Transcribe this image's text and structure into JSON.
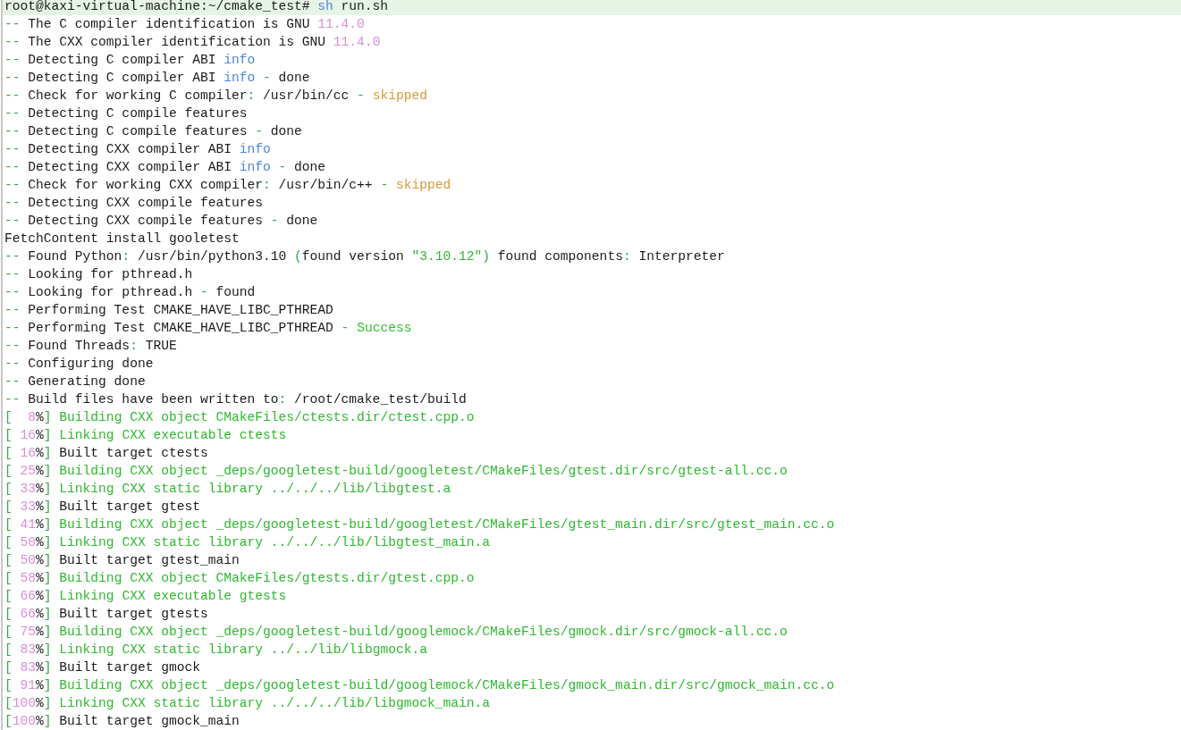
{
  "terminal": {
    "lines": [
      {
        "kind": "prompt",
        "parts": [
          {
            "kind": "text",
            "text": "root@kaxi-virtual-machine:~/cmake_test# "
          },
          {
            "kind": "info",
            "text": "sh"
          },
          {
            "kind": "text",
            "text": " run.sh"
          }
        ]
      },
      {
        "kind": "output",
        "parts": [
          {
            "kind": "dim",
            "text": "-- "
          },
          {
            "kind": "text",
            "text": "The C compiler identification is GNU "
          },
          {
            "kind": "num",
            "text": "11.4.0"
          }
        ]
      },
      {
        "kind": "output",
        "parts": [
          {
            "kind": "dim",
            "text": "-- "
          },
          {
            "kind": "text",
            "text": "The CXX compiler identification is GNU "
          },
          {
            "kind": "num",
            "text": "11.4.0"
          }
        ]
      },
      {
        "kind": "output",
        "parts": [
          {
            "kind": "dim",
            "text": "-- "
          },
          {
            "kind": "text",
            "text": "Detecting C compiler ABI "
          },
          {
            "kind": "info",
            "text": "info"
          }
        ]
      },
      {
        "kind": "output",
        "parts": [
          {
            "kind": "dim",
            "text": "-- "
          },
          {
            "kind": "text",
            "text": "Detecting C compiler ABI "
          },
          {
            "kind": "info",
            "text": "info"
          },
          {
            "kind": "dim",
            "text": " - "
          },
          {
            "kind": "text",
            "text": "done"
          }
        ]
      },
      {
        "kind": "output",
        "parts": [
          {
            "kind": "dim",
            "text": "-- "
          },
          {
            "kind": "text",
            "text": "Check for working C compiler"
          },
          {
            "kind": "dim",
            "text": ": "
          },
          {
            "kind": "text",
            "text": "/usr/bin/cc"
          },
          {
            "kind": "dim",
            "text": " - "
          },
          {
            "kind": "warn",
            "text": "skipped"
          }
        ]
      },
      {
        "kind": "output",
        "parts": [
          {
            "kind": "dim",
            "text": "-- "
          },
          {
            "kind": "text",
            "text": "Detecting C compile features"
          }
        ]
      },
      {
        "kind": "output",
        "parts": [
          {
            "kind": "dim",
            "text": "-- "
          },
          {
            "kind": "text",
            "text": "Detecting C compile features"
          },
          {
            "kind": "dim",
            "text": " - "
          },
          {
            "kind": "text",
            "text": "done"
          }
        ]
      },
      {
        "kind": "output",
        "parts": [
          {
            "kind": "dim",
            "text": "-- "
          },
          {
            "kind": "text",
            "text": "Detecting CXX compiler ABI "
          },
          {
            "kind": "info",
            "text": "info"
          }
        ]
      },
      {
        "kind": "output",
        "parts": [
          {
            "kind": "dim",
            "text": "-- "
          },
          {
            "kind": "text",
            "text": "Detecting CXX compiler ABI "
          },
          {
            "kind": "info",
            "text": "info"
          },
          {
            "kind": "dim",
            "text": " - "
          },
          {
            "kind": "text",
            "text": "done"
          }
        ]
      },
      {
        "kind": "output",
        "parts": [
          {
            "kind": "dim",
            "text": "-- "
          },
          {
            "kind": "text",
            "text": "Check for working CXX compiler"
          },
          {
            "kind": "dim",
            "text": ": "
          },
          {
            "kind": "text",
            "text": "/usr/bin/c++"
          },
          {
            "kind": "dim",
            "text": " - "
          },
          {
            "kind": "warn",
            "text": "skipped"
          }
        ]
      },
      {
        "kind": "output",
        "parts": [
          {
            "kind": "dim",
            "text": "-- "
          },
          {
            "kind": "text",
            "text": "Detecting CXX compile features"
          }
        ]
      },
      {
        "kind": "output",
        "parts": [
          {
            "kind": "dim",
            "text": "-- "
          },
          {
            "kind": "text",
            "text": "Detecting CXX compile features"
          },
          {
            "kind": "dim",
            "text": " - "
          },
          {
            "kind": "text",
            "text": "done"
          }
        ]
      },
      {
        "kind": "output",
        "parts": [
          {
            "kind": "text",
            "text": "FetchContent install gooletest"
          }
        ]
      },
      {
        "kind": "output",
        "parts": [
          {
            "kind": "dim",
            "text": "-- "
          },
          {
            "kind": "text",
            "text": "Found Python"
          },
          {
            "kind": "dim",
            "text": ": "
          },
          {
            "kind": "text",
            "text": "/usr/bin/python3.10 "
          },
          {
            "kind": "dim",
            "text": "("
          },
          {
            "kind": "text",
            "text": "found version "
          },
          {
            "kind": "green",
            "text": "\"3.10.12\""
          },
          {
            "kind": "dim",
            "text": ")"
          },
          {
            "kind": "text",
            "text": " found components"
          },
          {
            "kind": "dim",
            "text": ": "
          },
          {
            "kind": "text",
            "text": "Interpreter"
          }
        ]
      },
      {
        "kind": "output",
        "parts": [
          {
            "kind": "dim",
            "text": "-- "
          },
          {
            "kind": "text",
            "text": "Looking for pthread.h"
          }
        ]
      },
      {
        "kind": "output",
        "parts": [
          {
            "kind": "dim",
            "text": "-- "
          },
          {
            "kind": "text",
            "text": "Looking for pthread.h"
          },
          {
            "kind": "dim",
            "text": " - "
          },
          {
            "kind": "text",
            "text": "found"
          }
        ]
      },
      {
        "kind": "output",
        "parts": [
          {
            "kind": "dim",
            "text": "-- "
          },
          {
            "kind": "text",
            "text": "Performing Test CMAKE_HAVE_LIBC_PTHREAD"
          }
        ]
      },
      {
        "kind": "output",
        "parts": [
          {
            "kind": "dim",
            "text": "-- "
          },
          {
            "kind": "text",
            "text": "Performing Test CMAKE_HAVE_LIBC_PTHREAD"
          },
          {
            "kind": "dim",
            "text": " - "
          },
          {
            "kind": "ok",
            "text": "Success"
          }
        ]
      },
      {
        "kind": "output",
        "parts": [
          {
            "kind": "dim",
            "text": "-- "
          },
          {
            "kind": "text",
            "text": "Found Threads"
          },
          {
            "kind": "dim",
            "text": ": "
          },
          {
            "kind": "text",
            "text": "TRUE"
          }
        ]
      },
      {
        "kind": "output",
        "parts": [
          {
            "kind": "dim",
            "text": "-- "
          },
          {
            "kind": "text",
            "text": "Configuring done"
          }
        ]
      },
      {
        "kind": "output",
        "parts": [
          {
            "kind": "dim",
            "text": "-- "
          },
          {
            "kind": "text",
            "text": "Generating done"
          }
        ]
      },
      {
        "kind": "output",
        "parts": [
          {
            "kind": "dim",
            "text": "-- "
          },
          {
            "kind": "text",
            "text": "Build files have been written to"
          },
          {
            "kind": "dim",
            "text": ": "
          },
          {
            "kind": "text",
            "text": "/root/cmake_test/build"
          }
        ]
      },
      {
        "kind": "output",
        "parts": [
          {
            "kind": "dim",
            "text": "["
          },
          {
            "kind": "num",
            "text": "  8"
          },
          {
            "kind": "text",
            "text": "%"
          },
          {
            "kind": "dim",
            "text": "] "
          },
          {
            "kind": "green",
            "text": "Building CXX object CMakeFiles/ctests.dir/ctest.cpp.o"
          }
        ]
      },
      {
        "kind": "output",
        "parts": [
          {
            "kind": "dim",
            "text": "["
          },
          {
            "kind": "num",
            "text": " 16"
          },
          {
            "kind": "text",
            "text": "%"
          },
          {
            "kind": "dim",
            "text": "] "
          },
          {
            "kind": "green",
            "text": "Linking CXX executable ctests"
          }
        ]
      },
      {
        "kind": "output",
        "parts": [
          {
            "kind": "dim",
            "text": "["
          },
          {
            "kind": "num",
            "text": " 16"
          },
          {
            "kind": "text",
            "text": "%"
          },
          {
            "kind": "dim",
            "text": "] "
          },
          {
            "kind": "text",
            "text": "Built target ctests"
          }
        ]
      },
      {
        "kind": "output",
        "parts": [
          {
            "kind": "dim",
            "text": "["
          },
          {
            "kind": "num",
            "text": " 25"
          },
          {
            "kind": "text",
            "text": "%"
          },
          {
            "kind": "dim",
            "text": "] "
          },
          {
            "kind": "green",
            "text": "Building CXX object _deps/googletest-build/googletest/CMakeFiles/gtest.dir/src/gtest-all.cc.o"
          }
        ]
      },
      {
        "kind": "output",
        "parts": [
          {
            "kind": "dim",
            "text": "["
          },
          {
            "kind": "num",
            "text": " 33"
          },
          {
            "kind": "text",
            "text": "%"
          },
          {
            "kind": "dim",
            "text": "] "
          },
          {
            "kind": "green",
            "text": "Linking CXX static library ../../../lib/libgtest.a"
          }
        ]
      },
      {
        "kind": "output",
        "parts": [
          {
            "kind": "dim",
            "text": "["
          },
          {
            "kind": "num",
            "text": " 33"
          },
          {
            "kind": "text",
            "text": "%"
          },
          {
            "kind": "dim",
            "text": "] "
          },
          {
            "kind": "text",
            "text": "Built target gtest"
          }
        ]
      },
      {
        "kind": "output",
        "parts": [
          {
            "kind": "dim",
            "text": "["
          },
          {
            "kind": "num",
            "text": " 41"
          },
          {
            "kind": "text",
            "text": "%"
          },
          {
            "kind": "dim",
            "text": "] "
          },
          {
            "kind": "green",
            "text": "Building CXX object _deps/googletest-build/googletest/CMakeFiles/gtest_main.dir/src/gtest_main.cc.o"
          }
        ]
      },
      {
        "kind": "output",
        "parts": [
          {
            "kind": "dim",
            "text": "["
          },
          {
            "kind": "num",
            "text": " 50"
          },
          {
            "kind": "text",
            "text": "%"
          },
          {
            "kind": "dim",
            "text": "] "
          },
          {
            "kind": "green",
            "text": "Linking CXX static library ../../../lib/libgtest_main.a"
          }
        ]
      },
      {
        "kind": "output",
        "parts": [
          {
            "kind": "dim",
            "text": "["
          },
          {
            "kind": "num",
            "text": " 50"
          },
          {
            "kind": "text",
            "text": "%"
          },
          {
            "kind": "dim",
            "text": "] "
          },
          {
            "kind": "text",
            "text": "Built target gtest_main"
          }
        ]
      },
      {
        "kind": "output",
        "parts": [
          {
            "kind": "dim",
            "text": "["
          },
          {
            "kind": "num",
            "text": " 58"
          },
          {
            "kind": "text",
            "text": "%"
          },
          {
            "kind": "dim",
            "text": "] "
          },
          {
            "kind": "green",
            "text": "Building CXX object CMakeFiles/gtests.dir/gtest.cpp.o"
          }
        ]
      },
      {
        "kind": "output",
        "parts": [
          {
            "kind": "dim",
            "text": "["
          },
          {
            "kind": "num",
            "text": " 66"
          },
          {
            "kind": "text",
            "text": "%"
          },
          {
            "kind": "dim",
            "text": "] "
          },
          {
            "kind": "green",
            "text": "Linking CXX executable gtests"
          }
        ]
      },
      {
        "kind": "output",
        "parts": [
          {
            "kind": "dim",
            "text": "["
          },
          {
            "kind": "num",
            "text": " 66"
          },
          {
            "kind": "text",
            "text": "%"
          },
          {
            "kind": "dim",
            "text": "] "
          },
          {
            "kind": "text",
            "text": "Built target gtests"
          }
        ]
      },
      {
        "kind": "output",
        "parts": [
          {
            "kind": "dim",
            "text": "["
          },
          {
            "kind": "num",
            "text": " 75"
          },
          {
            "kind": "text",
            "text": "%"
          },
          {
            "kind": "dim",
            "text": "] "
          },
          {
            "kind": "green",
            "text": "Building CXX object _deps/googletest-build/googlemock/CMakeFiles/gmock.dir/src/gmock-all.cc.o"
          }
        ]
      },
      {
        "kind": "output",
        "parts": [
          {
            "kind": "dim",
            "text": "["
          },
          {
            "kind": "num",
            "text": " 83"
          },
          {
            "kind": "text",
            "text": "%"
          },
          {
            "kind": "dim",
            "text": "] "
          },
          {
            "kind": "green",
            "text": "Linking CXX static library ../../lib/libgmock.a"
          }
        ]
      },
      {
        "kind": "output",
        "parts": [
          {
            "kind": "dim",
            "text": "["
          },
          {
            "kind": "num",
            "text": " 83"
          },
          {
            "kind": "text",
            "text": "%"
          },
          {
            "kind": "dim",
            "text": "] "
          },
          {
            "kind": "text",
            "text": "Built target gmock"
          }
        ]
      },
      {
        "kind": "output",
        "parts": [
          {
            "kind": "dim",
            "text": "["
          },
          {
            "kind": "num",
            "text": " 91"
          },
          {
            "kind": "text",
            "text": "%"
          },
          {
            "kind": "dim",
            "text": "] "
          },
          {
            "kind": "green",
            "text": "Building CXX object _deps/googletest-build/googlemock/CMakeFiles/gmock_main.dir/src/gmock_main.cc.o"
          }
        ]
      },
      {
        "kind": "output",
        "parts": [
          {
            "kind": "dim",
            "text": "["
          },
          {
            "kind": "num",
            "text": "100"
          },
          {
            "kind": "text",
            "text": "%"
          },
          {
            "kind": "dim",
            "text": "] "
          },
          {
            "kind": "green",
            "text": "Linking CXX static library ../../../lib/libgmock_main.a"
          }
        ]
      },
      {
        "kind": "output",
        "parts": [
          {
            "kind": "dim",
            "text": "["
          },
          {
            "kind": "num",
            "text": "100"
          },
          {
            "kind": "text",
            "text": "%"
          },
          {
            "kind": "dim",
            "text": "] "
          },
          {
            "kind": "text",
            "text": "Built target gmock_main"
          }
        ]
      }
    ]
  }
}
